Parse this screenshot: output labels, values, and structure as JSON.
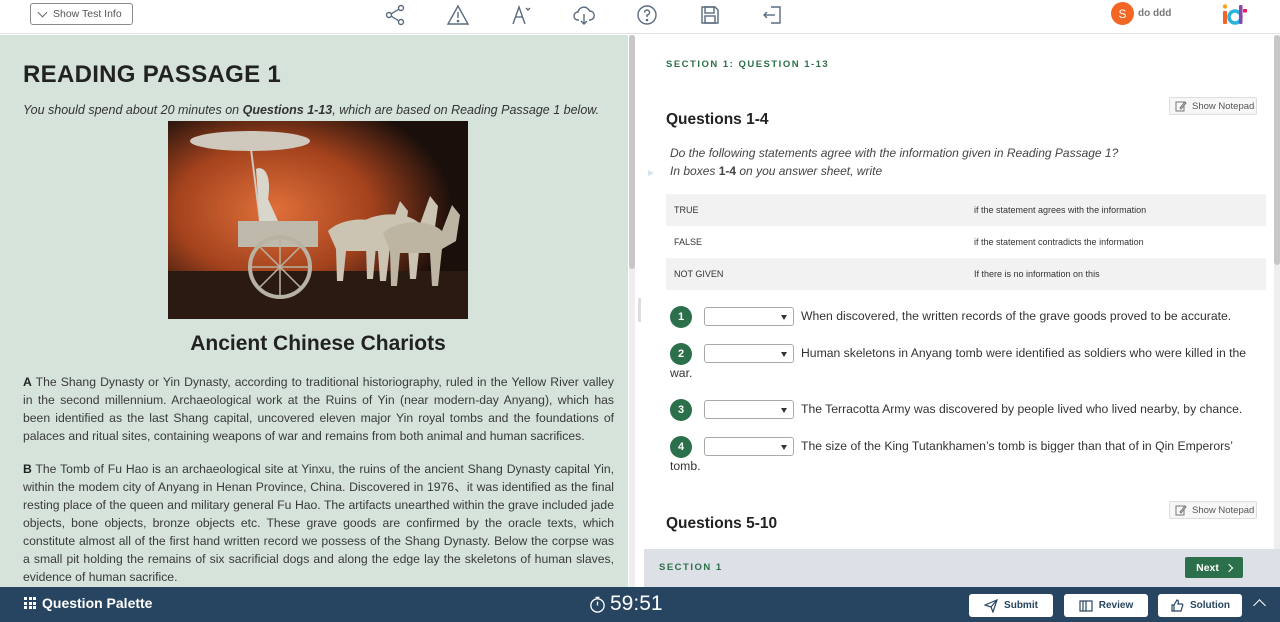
{
  "topbar": {
    "show_test_info": "Show Test Info",
    "tools": [
      "share-icon",
      "warning-icon",
      "font-size-icon",
      "download-icon",
      "help-icon",
      "save-icon",
      "exit-icon"
    ],
    "user_initial": "S",
    "user_name": "do ddd"
  },
  "passage": {
    "title": "READING PASSAGE 1",
    "intro_pre": "You should spend about 20 minutes on ",
    "intro_bold": "Questions 1-13",
    "intro_post": ", which are based on Reading Passage 1 below.",
    "heading": "Ancient Chinese Chariots",
    "paragraphs": [
      {
        "letter": "A",
        "text": " The Shang Dynasty or Yin Dynasty, according to traditional historiography, ruled in the Yellow River valley in the second millennium. Archaeological work at the Ruins of Yin (near modern-day Anyang), which has been identified as the last Shang capital, uncovered eleven major Yin royal tombs and the foundations of palaces and ritual sites, containing weapons of war and remains from both animal and human sacrifices."
      },
      {
        "letter": "B",
        "text": " The Tomb of Fu Hao is an archaeological site at Yinxu, the ruins of the ancient Shang Dynasty capital Yin, within the modem city of Anyang in Henan Province, China. Discovered in 1976、it was identified as the final resting place of the queen and military general Fu Hao. The artifacts unearthed within the grave included jade objects, bone objects, bronze objects etc. These grave goods are confirmed by the oracle texts, which constitute almost all of the first hand written record we possess of the Shang Dynasty. Below the corpse was a small pit holding the remains of six sacrificial dogs and along the edge lay the skeletons of human slaves, evidence of human sacrifice."
      }
    ]
  },
  "questions_panel": {
    "section_label": "SECTION 1: QUESTION 1-13",
    "notepad_label": "Show Notepad",
    "group1_title": "Questions 1-4",
    "instr1": "Do the following statements agree with the information given in Reading Passage 1?",
    "instr2_pre": "In boxes ",
    "instr2_bold": "1-4",
    "instr2_post": " on you answer sheet, write",
    "key_rows": [
      {
        "term": "TRUE",
        "def": "if the statement agrees with the information"
      },
      {
        "term": "FALSE",
        "def": "if the statement contradicts the information"
      },
      {
        "term": "NOT GIVEN",
        "def": "If there is no information on this"
      }
    ],
    "questions": [
      {
        "num": "1",
        "text": "When discovered, the written records of the grave goods proved to be accurate."
      },
      {
        "num": "2",
        "text": "Human skeletons in Anyang tomb were identified as soldiers who were killed in the war."
      },
      {
        "num": "3",
        "text": "The Terracotta Army was discovered by people lived who lived nearby, by chance."
      },
      {
        "num": "4",
        "text": "The size of the King Tutankhamen’s tomb is bigger than that of in Qin Emperors’ tomb."
      }
    ],
    "group2_title": "Questions 5-10"
  },
  "section_strip": {
    "label": "SECTION 1",
    "next_label": "Next"
  },
  "bottombar": {
    "palette_label": "Question Palette",
    "timer": "59:51",
    "submit_label": "Submit",
    "review_label": "Review",
    "solution_label": "Solution"
  },
  "colors": {
    "accent_green": "#2c6f4b",
    "left_panel_bg": "#d5e3da",
    "bottom_bar": "#274560",
    "avatar": "#f26522"
  }
}
